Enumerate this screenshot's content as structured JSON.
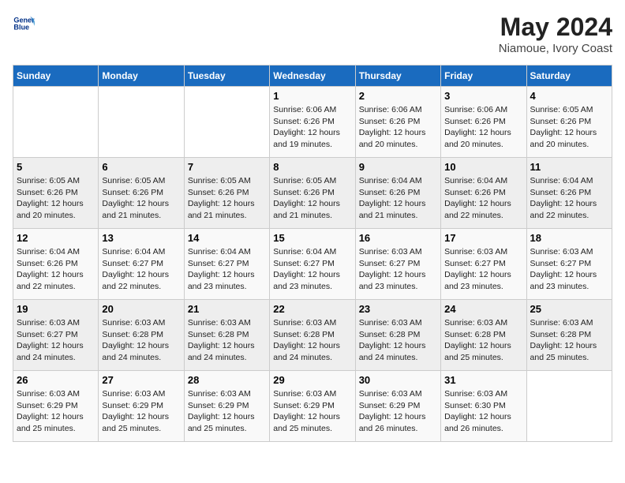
{
  "header": {
    "logo_line1": "General",
    "logo_line2": "Blue",
    "month_year": "May 2024",
    "location": "Niamoue, Ivory Coast"
  },
  "weekdays": [
    "Sunday",
    "Monday",
    "Tuesday",
    "Wednesday",
    "Thursday",
    "Friday",
    "Saturday"
  ],
  "weeks": [
    [
      {
        "day": "",
        "info": ""
      },
      {
        "day": "",
        "info": ""
      },
      {
        "day": "",
        "info": ""
      },
      {
        "day": "1",
        "info": "Sunrise: 6:06 AM\nSunset: 6:26 PM\nDaylight: 12 hours\nand 19 minutes."
      },
      {
        "day": "2",
        "info": "Sunrise: 6:06 AM\nSunset: 6:26 PM\nDaylight: 12 hours\nand 20 minutes."
      },
      {
        "day": "3",
        "info": "Sunrise: 6:06 AM\nSunset: 6:26 PM\nDaylight: 12 hours\nand 20 minutes."
      },
      {
        "day": "4",
        "info": "Sunrise: 6:05 AM\nSunset: 6:26 PM\nDaylight: 12 hours\nand 20 minutes."
      }
    ],
    [
      {
        "day": "5",
        "info": "Sunrise: 6:05 AM\nSunset: 6:26 PM\nDaylight: 12 hours\nand 20 minutes."
      },
      {
        "day": "6",
        "info": "Sunrise: 6:05 AM\nSunset: 6:26 PM\nDaylight: 12 hours\nand 21 minutes."
      },
      {
        "day": "7",
        "info": "Sunrise: 6:05 AM\nSunset: 6:26 PM\nDaylight: 12 hours\nand 21 minutes."
      },
      {
        "day": "8",
        "info": "Sunrise: 6:05 AM\nSunset: 6:26 PM\nDaylight: 12 hours\nand 21 minutes."
      },
      {
        "day": "9",
        "info": "Sunrise: 6:04 AM\nSunset: 6:26 PM\nDaylight: 12 hours\nand 21 minutes."
      },
      {
        "day": "10",
        "info": "Sunrise: 6:04 AM\nSunset: 6:26 PM\nDaylight: 12 hours\nand 22 minutes."
      },
      {
        "day": "11",
        "info": "Sunrise: 6:04 AM\nSunset: 6:26 PM\nDaylight: 12 hours\nand 22 minutes."
      }
    ],
    [
      {
        "day": "12",
        "info": "Sunrise: 6:04 AM\nSunset: 6:26 PM\nDaylight: 12 hours\nand 22 minutes."
      },
      {
        "day": "13",
        "info": "Sunrise: 6:04 AM\nSunset: 6:27 PM\nDaylight: 12 hours\nand 22 minutes."
      },
      {
        "day": "14",
        "info": "Sunrise: 6:04 AM\nSunset: 6:27 PM\nDaylight: 12 hours\nand 23 minutes."
      },
      {
        "day": "15",
        "info": "Sunrise: 6:04 AM\nSunset: 6:27 PM\nDaylight: 12 hours\nand 23 minutes."
      },
      {
        "day": "16",
        "info": "Sunrise: 6:03 AM\nSunset: 6:27 PM\nDaylight: 12 hours\nand 23 minutes."
      },
      {
        "day": "17",
        "info": "Sunrise: 6:03 AM\nSunset: 6:27 PM\nDaylight: 12 hours\nand 23 minutes."
      },
      {
        "day": "18",
        "info": "Sunrise: 6:03 AM\nSunset: 6:27 PM\nDaylight: 12 hours\nand 23 minutes."
      }
    ],
    [
      {
        "day": "19",
        "info": "Sunrise: 6:03 AM\nSunset: 6:27 PM\nDaylight: 12 hours\nand 24 minutes."
      },
      {
        "day": "20",
        "info": "Sunrise: 6:03 AM\nSunset: 6:28 PM\nDaylight: 12 hours\nand 24 minutes."
      },
      {
        "day": "21",
        "info": "Sunrise: 6:03 AM\nSunset: 6:28 PM\nDaylight: 12 hours\nand 24 minutes."
      },
      {
        "day": "22",
        "info": "Sunrise: 6:03 AM\nSunset: 6:28 PM\nDaylight: 12 hours\nand 24 minutes."
      },
      {
        "day": "23",
        "info": "Sunrise: 6:03 AM\nSunset: 6:28 PM\nDaylight: 12 hours\nand 24 minutes."
      },
      {
        "day": "24",
        "info": "Sunrise: 6:03 AM\nSunset: 6:28 PM\nDaylight: 12 hours\nand 25 minutes."
      },
      {
        "day": "25",
        "info": "Sunrise: 6:03 AM\nSunset: 6:28 PM\nDaylight: 12 hours\nand 25 minutes."
      }
    ],
    [
      {
        "day": "26",
        "info": "Sunrise: 6:03 AM\nSunset: 6:29 PM\nDaylight: 12 hours\nand 25 minutes."
      },
      {
        "day": "27",
        "info": "Sunrise: 6:03 AM\nSunset: 6:29 PM\nDaylight: 12 hours\nand 25 minutes."
      },
      {
        "day": "28",
        "info": "Sunrise: 6:03 AM\nSunset: 6:29 PM\nDaylight: 12 hours\nand 25 minutes."
      },
      {
        "day": "29",
        "info": "Sunrise: 6:03 AM\nSunset: 6:29 PM\nDaylight: 12 hours\nand 25 minutes."
      },
      {
        "day": "30",
        "info": "Sunrise: 6:03 AM\nSunset: 6:29 PM\nDaylight: 12 hours\nand 26 minutes."
      },
      {
        "day": "31",
        "info": "Sunrise: 6:03 AM\nSunset: 6:30 PM\nDaylight: 12 hours\nand 26 minutes."
      },
      {
        "day": "",
        "info": ""
      }
    ]
  ]
}
